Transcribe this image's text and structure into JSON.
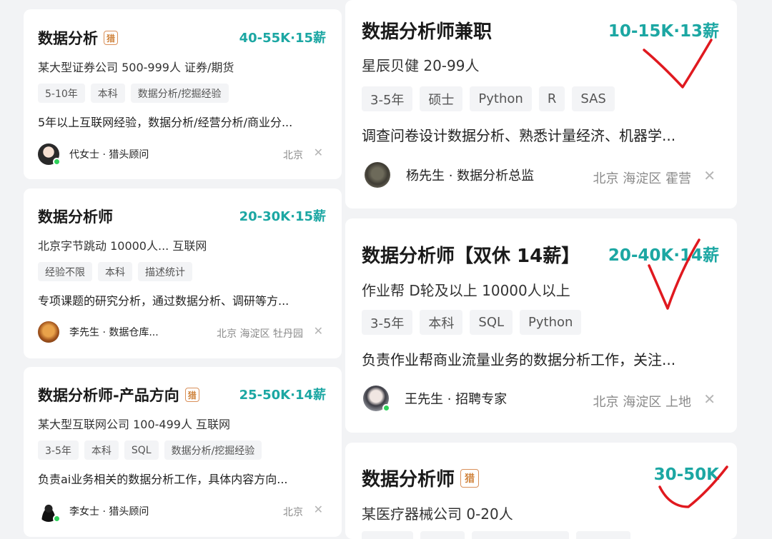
{
  "left_cards": [
    {
      "title": "数据分析",
      "hunter_badge": "猎",
      "salary": "40-55K·15薪",
      "company": "某大型证券公司 500-999人 证券/期货",
      "tags": [
        "5-10年",
        "本科",
        "数据分析/挖掘经验"
      ],
      "description": "5年以上互联网经验，数据分析/经营分析/商业分...",
      "recruiter": "代女士 · 猎头顾问",
      "location": "北京",
      "close": "✕"
    },
    {
      "title": "数据分析师",
      "salary": "20-30K·15薪",
      "company": "北京字节跳动 10000人... 互联网",
      "tags": [
        "经验不限",
        "本科",
        "描述统计"
      ],
      "description": "专项课题的研究分析，通过数据分析、调研等方...",
      "recruiter": "李先生 · 数据仓库...",
      "location": "北京 海淀区 牡丹园",
      "close": "✕"
    },
    {
      "title": "数据分析师-产品方向",
      "hunter_badge": "猎",
      "salary": "25-50K·14薪",
      "company": "某大型互联网公司 100-499人 互联网",
      "tags": [
        "3-5年",
        "本科",
        "SQL",
        "数据分析/挖掘经验"
      ],
      "description": "负责ai业务相关的数据分析工作，具体内容方向...",
      "recruiter": "李女士 · 猎头顾问",
      "location": "北京",
      "close": "✕"
    }
  ],
  "right_cards": [
    {
      "title": "数据分析师兼职",
      "salary": "10-15K·13薪",
      "company": "星辰贝健 20-99人",
      "tags": [
        "3-5年",
        "硕士",
        "Python",
        "R",
        "SAS"
      ],
      "description": "调查问卷设计数据分析、熟悉计量经济、机器学...",
      "recruiter": "杨先生 · 数据分析总监",
      "location": "北京 海淀区 霍营",
      "close": "✕"
    },
    {
      "title": "数据分析师【双休 14薪】",
      "salary": "20-40K·14薪",
      "company": "作业帮 D轮及以上 10000人以上",
      "tags": [
        "3-5年",
        "本科",
        "SQL",
        "Python"
      ],
      "description": "负责作业帮商业流量业务的数据分析工作，关注...",
      "recruiter": "王先生 · 招聘专家",
      "location": "北京 海淀区 上地",
      "close": "✕"
    },
    {
      "title": "数据分析师",
      "hunter_badge": "猎",
      "salary": "30-50K",
      "company": "某医疗器械公司 0-20人"
    }
  ],
  "colors": {
    "salary": "#1ca7a3",
    "hunter_badge": "#d0843e",
    "online_dot": "#2fd15a",
    "check_mark": "#e0191f"
  },
  "icons": [
    "hunter-badge-icon",
    "close-icon",
    "avatar",
    "online-dot-icon",
    "check-mark-annotation"
  ]
}
